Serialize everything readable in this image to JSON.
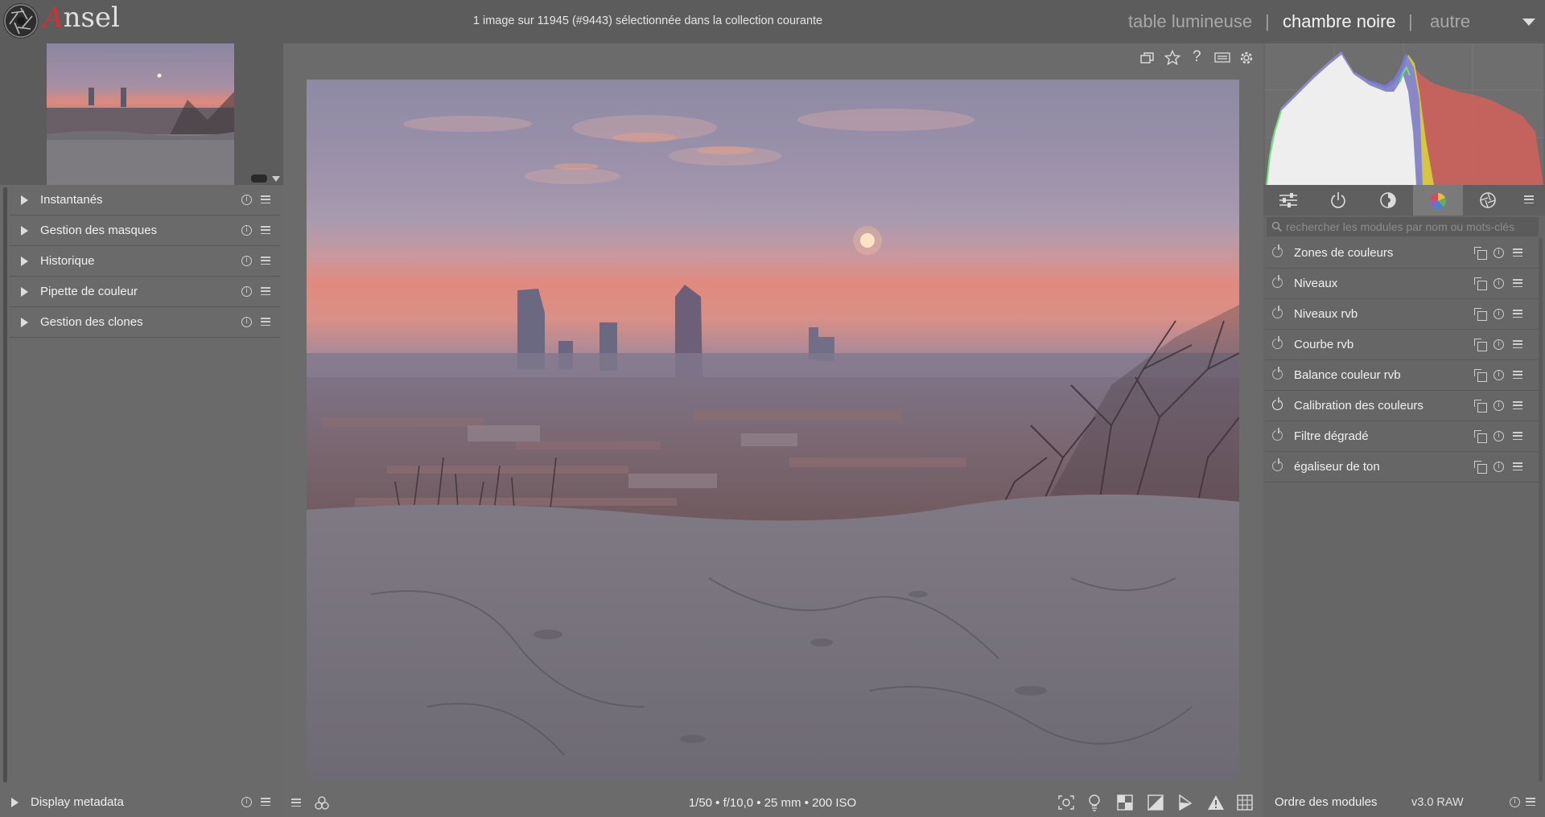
{
  "app": {
    "name": "Ansel",
    "name_first": "A",
    "name_rest": "nsel"
  },
  "header": {
    "status": "1 image sur 11945 (#9443) sélectionnée dans la collection courante",
    "views": [
      "table lumineuse",
      "chambre noire",
      "autre"
    ],
    "active_view": "chambre noire",
    "separator": "|"
  },
  "left_panel": {
    "modules": [
      {
        "label": "Instantanés"
      },
      {
        "label": "Gestion des masques"
      },
      {
        "label": "Historique"
      },
      {
        "label": "Pipette de couleur"
      },
      {
        "label": "Gestion des clones"
      }
    ],
    "bottom_module": {
      "label": "Display metadata"
    }
  },
  "center": {
    "toolbar_icons": [
      "duplicate-icon",
      "star-icon",
      "help-icon",
      "keyboard-icon",
      "gear-icon"
    ],
    "exif": "1/50 • f/10,0 • 25 mm • 200 ISO",
    "bottom_left_icons": [
      "filmstrip-menu-icon",
      "styles-icon"
    ],
    "bottom_right_icons": [
      "focus-peaking-icon",
      "bulb-icon",
      "display-profile-icon",
      "softproof-icon",
      "gamut-check-icon",
      "overexposed-icon",
      "guides-icon"
    ]
  },
  "right_panel": {
    "search_placeholder": "rechercher les modules par nom ou mots-clés",
    "group_tabs": [
      "sliders-icon",
      "power-icon",
      "tone-icon",
      "color-icon",
      "aperture-icon",
      "menu-icon"
    ],
    "active_group": "color-icon",
    "modules": [
      {
        "label": "Zones de couleurs"
      },
      {
        "label": "Niveaux"
      },
      {
        "label": "Niveaux rvb"
      },
      {
        "label": "Courbe rvb"
      },
      {
        "label": "Balance couleur rvb"
      },
      {
        "label": "Calibration des couleurs"
      },
      {
        "label": "Filtre dégradé"
      },
      {
        "label": "égaliseur de ton"
      }
    ],
    "bottom_label": "Ordre des modules",
    "bottom_value": "v3.0 RAW"
  },
  "colors": {
    "background": "#6b6b6b",
    "panel": "#666666",
    "sky_top": "#8d8aa3",
    "sunset": "#e08a7e",
    "histogram_red": "#d76a64"
  }
}
